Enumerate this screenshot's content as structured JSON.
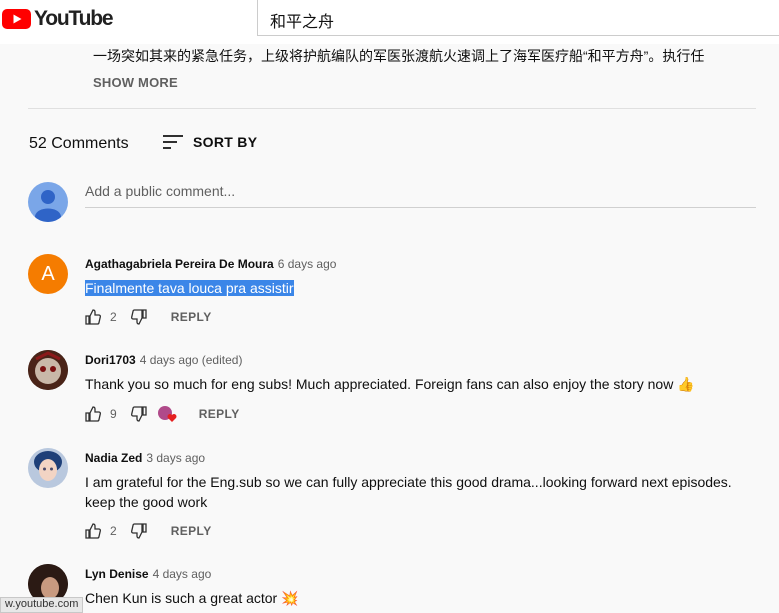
{
  "header": {
    "logo_text": "YouTube",
    "search_value": "和平之舟"
  },
  "description": {
    "text": "一场突如其来的紧急任务，上级将护航编队的军医张渡航火速调上了海军医疗船“和平方舟”。执行任",
    "show_more": "SHOW MORE"
  },
  "comments_header": {
    "count_label": "52 Comments",
    "sort_label": "SORT BY"
  },
  "composer": {
    "placeholder": "Add a public comment..."
  },
  "comments": [
    {
      "avatar_letter": "A",
      "author": "Agathagabriela Pereira De Moura",
      "time": "6 days ago",
      "text": "Finalmente tava louca pra assistir",
      "likes": "2",
      "reply": "REPLY"
    },
    {
      "author": "Dori1703",
      "time": "4 days ago (edited)",
      "text": "Thank you so much for eng subs! Much appreciated. Foreign fans can also enjoy the story now 👍",
      "likes": "9",
      "reply": "REPLY"
    },
    {
      "author": "Nadia Zed",
      "time": "3 days ago",
      "text": "I am grateful for the Eng.sub  so we  can fully appreciate this  good drama...looking forward next episodes. keep the good work",
      "likes": "2",
      "reply": "REPLY"
    },
    {
      "author": "Lyn Denise",
      "time": "4 days ago",
      "text": "Chen Kun is such a great actor 💥"
    }
  ],
  "status_bar": {
    "url": "w.youtube.com"
  },
  "colors": {
    "brand_red": "#ff0000",
    "selection": "#3b86e8",
    "avatar_orange": "#f57c00"
  }
}
